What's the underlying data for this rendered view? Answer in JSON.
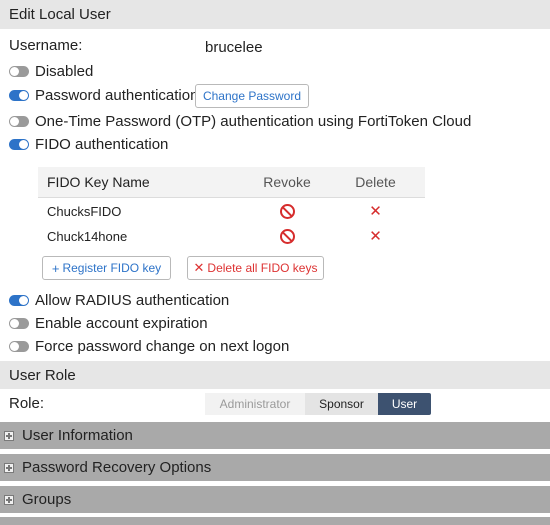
{
  "header": {
    "title": "Edit Local User"
  },
  "username": {
    "label": "Username:",
    "value": "brucelee"
  },
  "toggles": {
    "disabled": {
      "label": "Disabled",
      "on": false
    },
    "password_auth": {
      "label": "Password authentication",
      "on": true
    },
    "otp": {
      "label": "One-Time Password (OTP) authentication using FortiToken Cloud",
      "on": false
    },
    "fido": {
      "label": "FIDO authentication",
      "on": true
    },
    "radius": {
      "label": "Allow RADIUS authentication",
      "on": true
    },
    "expiration": {
      "label": "Enable account expiration",
      "on": false
    },
    "force_change": {
      "label": "Force password change on next logon",
      "on": false
    }
  },
  "change_password_button": "Change Password",
  "fido_table": {
    "headers": [
      "FIDO Key Name",
      "Revoke",
      "Delete"
    ],
    "rows": [
      {
        "name": "ChucksFIDO"
      },
      {
        "name": "Chuck14hone"
      }
    ]
  },
  "register_fido_button": "Register FIDO key",
  "delete_all_fido_button": "Delete all FIDO keys",
  "user_role": {
    "title": "User Role",
    "role_label": "Role:",
    "options": [
      "Administrator",
      "Sponsor",
      "User"
    ],
    "selected": "User"
  },
  "collapsibles": [
    "User Information",
    "Password Recovery Options",
    "Groups"
  ],
  "colors": {
    "accent": "#2d73c8",
    "danger": "#d62c2c",
    "selected_role": "#3d5270"
  }
}
